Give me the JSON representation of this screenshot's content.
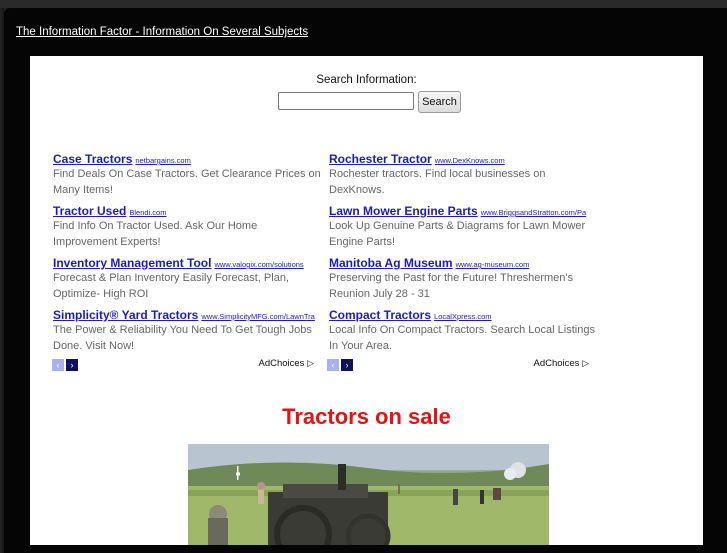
{
  "header": {
    "site_title": " The Information Factor - Information On Several Subjects"
  },
  "search": {
    "label": "Search Information:",
    "input_value": "",
    "button_label": "Search"
  },
  "ads": {
    "left": [
      {
        "title": "Case Tractors",
        "url": "netbargains.com",
        "desc": "Find Deals On Case Tractors. Get Clearance Prices on Many Items!"
      },
      {
        "title": "Tractor Used",
        "url": "Blendi.com",
        "desc": "Find Info On Tractor Used. Ask Our Home Improvement Experts!"
      },
      {
        "title": "Inventory Management Tool",
        "url": "www.valogix.com/solutions",
        "desc": "Forecast & Plan Inventory Easily Forecast, Plan, Optimize- High ROI"
      },
      {
        "title": "Simplicity® Yard Tractors",
        "url": "www.SimplicityMFG.com/LawnTra",
        "desc": "The Power & Reliability You Need To Get Tough Jobs Done. Visit Now!"
      }
    ],
    "right": [
      {
        "title": "Rochester Tractor",
        "url": "www.DexKnows.com",
        "desc": "Rochester tractors. Find local businesses on DexKnows."
      },
      {
        "title": "Lawn Mower Engine Parts",
        "url": "www.BriggsandStratton.com/Pa",
        "desc": "Look Up Genuine Parts & Diagrams for Lawn Mower Engine Parts!"
      },
      {
        "title": "Manitoba Ag Museum",
        "url": "www.ag-museum.com",
        "desc": "Preserving the Past for the Future! Threshermen's Reunion July 28 - 31"
      },
      {
        "title": "Compact Tractors",
        "url": "LocalXpress.com",
        "desc": "Local Info On Compact Tractors. Search Local Listings In Your Area."
      }
    ],
    "adchoices_label": "AdChoices",
    "adchoices_icon": "▷",
    "nav_prev": "‹",
    "nav_next": "›"
  },
  "main": {
    "heading": "Tractors on sale"
  },
  "colors": {
    "ad_link": "#1a1acc",
    "heading": "#e41212"
  }
}
